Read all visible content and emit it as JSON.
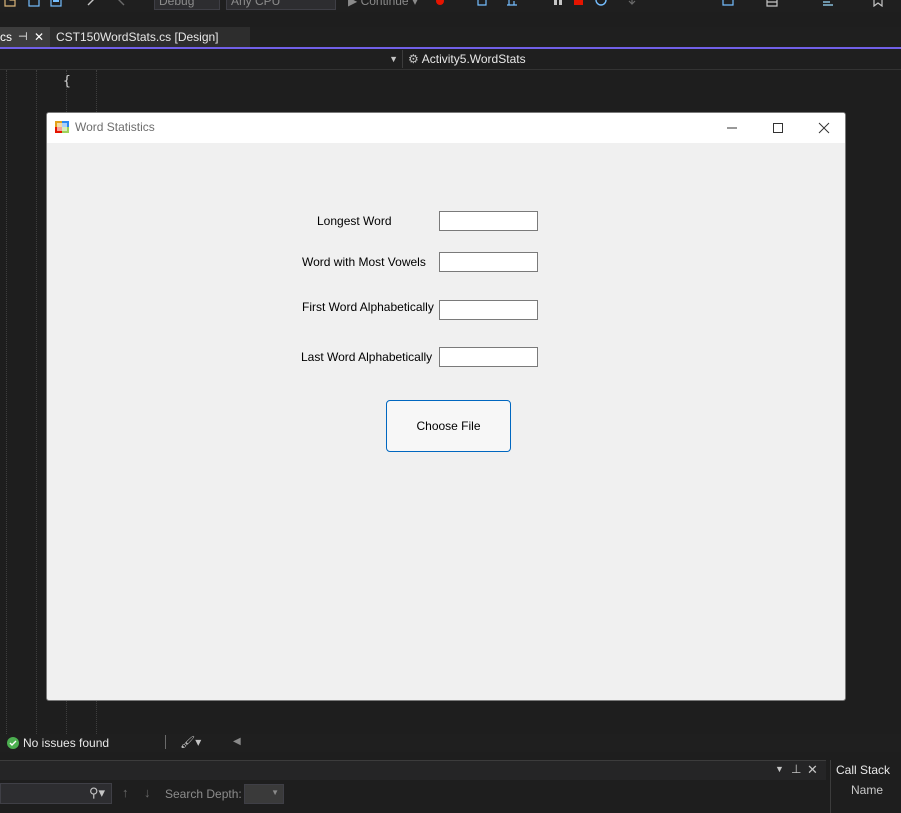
{
  "toolbar": {
    "config": "Debug",
    "platform": "Any CPU",
    "continue_label": "Continue"
  },
  "tabs": [
    {
      "label": "cs"
    },
    {
      "label": "CST150WordStats.cs [Design]"
    }
  ],
  "navbar": {
    "member": "Activity5.WordStats"
  },
  "editor": {
    "brace": "{"
  },
  "form": {
    "title": "Word Statistics",
    "labels": {
      "longest": "Longest Word",
      "vowels": "Word with Most Vowels",
      "first": "First Word Alphabetically",
      "last": "Last Word Alphabetically"
    },
    "values": {
      "longest": "",
      "vowels": "",
      "first": "",
      "last": ""
    },
    "choose_button": "Choose File"
  },
  "status": {
    "issues": "No issues found"
  },
  "panel": {
    "search_depth_label": "Search Depth:",
    "search_depth_value": ""
  },
  "callstack": {
    "title": "Call Stack",
    "column_name": "Name"
  },
  "colors": {
    "accent": "#7160e8",
    "button_border": "#0067c0",
    "success": "#4caf50"
  }
}
